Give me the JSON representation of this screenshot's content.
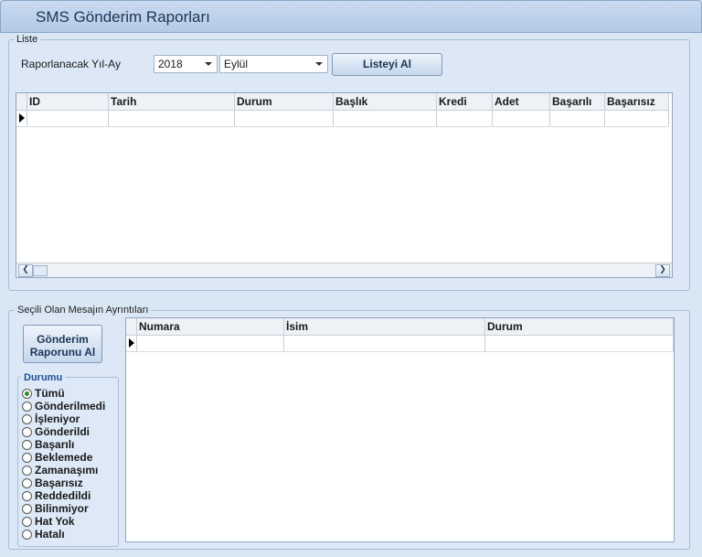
{
  "window": {
    "title": "SMS Gönderim Raporları"
  },
  "list_group": {
    "legend": "Liste",
    "period_label": "Raporlanacak Yıl-Ay",
    "year": "2018",
    "month": "Eylül",
    "fetch_button": "Listeyi Al",
    "columns": [
      "ID",
      "Tarih",
      "Durum",
      "Başlık",
      "Kredi",
      "Adet",
      "Başarılı",
      "Başarısız"
    ]
  },
  "detail_group": {
    "legend": "Seçili Olan Mesajın Ayrıntıları",
    "report_button": "Gönderim Raporunu Al",
    "status_legend": "Durumu",
    "status_options": [
      "Tümü",
      "Gönderilmedi",
      "İşleniyor",
      "Gönderildi",
      "Başarılı",
      "Beklemede",
      "Zamanaşımı",
      "Başarısız",
      "Reddedildi",
      "Bilinmiyor",
      "Hat Yok",
      "Hatalı"
    ],
    "selected_status": "Tümü",
    "columns": [
      "Numara",
      "İsim",
      "Durum"
    ]
  }
}
